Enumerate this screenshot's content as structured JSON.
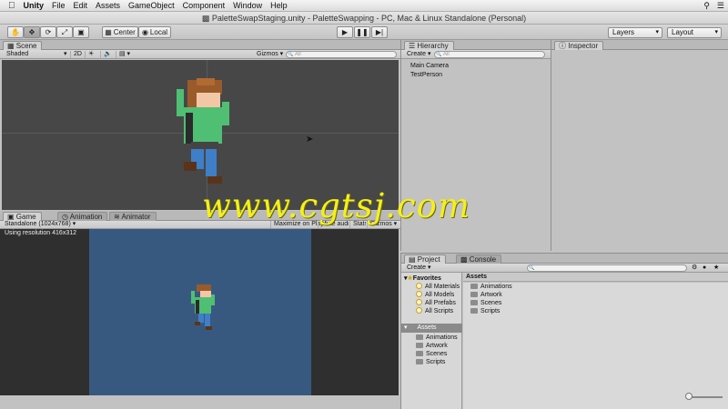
{
  "menubar": {
    "apple": "",
    "items": [
      "Unity",
      "File",
      "Edit",
      "Assets",
      "GameObject",
      "Component",
      "Window",
      "Help"
    ]
  },
  "window": {
    "title": "PaletteSwapStaging.unity - PaletteSwapping - PC, Mac & Linux Standalone (Personal)"
  },
  "toolbar": {
    "pivot_label": "Center",
    "space_label": "Local",
    "layers_label": "Layers",
    "layout_label": "Layout",
    "play_icon": "play-icon",
    "pause_icon": "pause-icon",
    "step_icon": "step-icon"
  },
  "scene": {
    "tab_label": "Scene",
    "shading": "Shaded",
    "mode_2d": "2D",
    "gizmos": "Gizmos",
    "search_placeholder": "All"
  },
  "hierarchy": {
    "tab_label": "Hierarchy",
    "create_label": "Create",
    "search_placeholder": "All",
    "items": [
      "Main Camera",
      "TestPerson"
    ]
  },
  "inspector": {
    "tab_label": "Inspector"
  },
  "game": {
    "tabs": [
      "Game",
      "Animation",
      "Animator"
    ],
    "resolution_dropdown": "Standalone (1024x768)",
    "maximize_label": "Maximize on Play",
    "mute_label": "Mute audio",
    "stats_label": "Stats",
    "gizmos_label": "Gizmos",
    "resolution_text": "Using resolution 416x312",
    "background_color": "#38597f"
  },
  "project": {
    "tabs": [
      "Project",
      "Console"
    ],
    "create_label": "Create",
    "favorites_label": "Favorites",
    "favorites": [
      "All Materials",
      "All Models",
      "All Prefabs",
      "All Scripts"
    ],
    "assets_root": "Assets",
    "asset_folders": [
      "Animations",
      "Artwork",
      "Scenes",
      "Scripts"
    ],
    "breadcrumb": "Assets",
    "content_folders": [
      "Animations",
      "Artwork",
      "Scenes",
      "Scripts"
    ]
  },
  "watermark": "www.cgtsj.com"
}
